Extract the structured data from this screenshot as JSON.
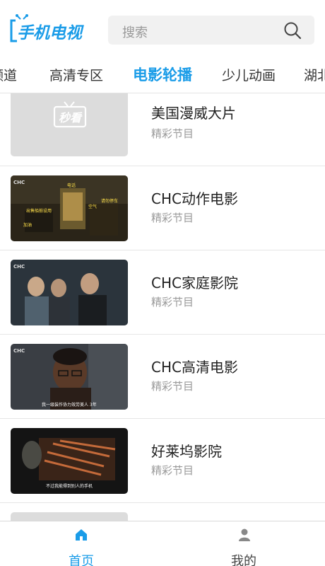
{
  "header": {
    "logo_text": "手机电视",
    "search_placeholder": "搜索"
  },
  "tabs": [
    {
      "label": "频道",
      "active": false
    },
    {
      "label": "高清专区",
      "active": false
    },
    {
      "label": "电影轮播",
      "active": true
    },
    {
      "label": "少儿动画",
      "active": false
    },
    {
      "label": "湖北",
      "active": false
    }
  ],
  "list": [
    {
      "title": "美国漫威大片",
      "subtitle": "精彩节目",
      "thumb": "placeholder",
      "placeholder_text": "秒看"
    },
    {
      "title": "CHC动作电影",
      "subtitle": "精彩节目",
      "thumb": "action"
    },
    {
      "title": "CHC家庭影院",
      "subtitle": "精彩节目",
      "thumb": "family"
    },
    {
      "title": "CHC高清电影",
      "subtitle": "精彩节目",
      "thumb": "hd"
    },
    {
      "title": "好莱坞影院",
      "subtitle": "精彩节目",
      "thumb": "hollywood"
    }
  ],
  "bottom_nav": [
    {
      "label": "首页",
      "icon": "home-icon",
      "active": true
    },
    {
      "label": "我的",
      "icon": "user-icon",
      "active": false
    }
  ],
  "colors": {
    "accent": "#1a9ce8",
    "inactive": "#888888"
  }
}
